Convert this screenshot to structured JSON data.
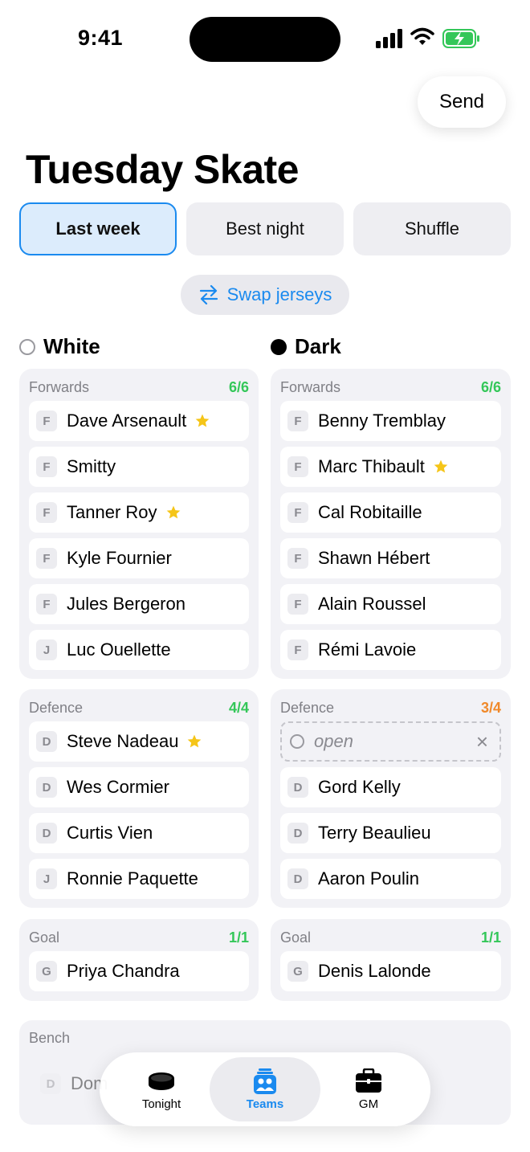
{
  "status": {
    "time": "9:41"
  },
  "header": {
    "send_label": "Send",
    "title": "Tuesday Skate"
  },
  "segments": [
    {
      "label": "Last week",
      "active": true
    },
    {
      "label": "Best night",
      "active": false
    },
    {
      "label": "Shuffle",
      "active": false
    }
  ],
  "swap_label": "Swap jerseys",
  "teams": {
    "white": {
      "name": "White",
      "forwards": {
        "label": "Forwards",
        "count": "6/6",
        "players": [
          {
            "pos": "F",
            "name": "Dave Arsenault",
            "star": true
          },
          {
            "pos": "F",
            "name": "Smitty",
            "star": false
          },
          {
            "pos": "F",
            "name": "Tanner Roy",
            "star": true
          },
          {
            "pos": "F",
            "name": "Kyle Fournier",
            "star": false
          },
          {
            "pos": "F",
            "name": "Jules Bergeron",
            "star": false
          },
          {
            "pos": "J",
            "name": "Luc Ouellette",
            "star": false
          }
        ]
      },
      "defence": {
        "label": "Defence",
        "count": "4/4",
        "players": [
          {
            "pos": "D",
            "name": "Steve Nadeau",
            "star": true
          },
          {
            "pos": "D",
            "name": "Wes Cormier",
            "star": false
          },
          {
            "pos": "D",
            "name": "Curtis Vien",
            "star": false
          },
          {
            "pos": "J",
            "name": "Ronnie Paquette",
            "star": false
          }
        ]
      },
      "goal": {
        "label": "Goal",
        "count": "1/1",
        "players": [
          {
            "pos": "G",
            "name": "Priya Chandra",
            "star": false
          }
        ]
      }
    },
    "dark": {
      "name": "Dark",
      "forwards": {
        "label": "Forwards",
        "count": "6/6",
        "players": [
          {
            "pos": "F",
            "name": "Benny Tremblay",
            "star": false
          },
          {
            "pos": "F",
            "name": "Marc Thibault",
            "star": true
          },
          {
            "pos": "F",
            "name": "Cal Robitaille",
            "star": false
          },
          {
            "pos": "F",
            "name": "Shawn Hébert",
            "star": false
          },
          {
            "pos": "F",
            "name": "Alain Roussel",
            "star": false
          },
          {
            "pos": "F",
            "name": "Rémi Lavoie",
            "star": false
          }
        ]
      },
      "defence": {
        "label": "Defence",
        "count": "3/4",
        "open_label": "open",
        "players": [
          {
            "pos": "D",
            "name": "Gord Kelly",
            "star": false
          },
          {
            "pos": "D",
            "name": "Terry Beaulieu",
            "star": false
          },
          {
            "pos": "D",
            "name": "Aaron Poulin",
            "star": false
          }
        ]
      },
      "goal": {
        "label": "Goal",
        "count": "1/1",
        "players": [
          {
            "pos": "G",
            "name": "Denis Lalonde",
            "star": false
          }
        ]
      }
    }
  },
  "bench": {
    "label": "Bench",
    "players": [
      {
        "pos": "D",
        "name": "Dom"
      }
    ]
  },
  "tabbar": [
    {
      "label": "Tonight",
      "icon": "puck-icon",
      "active": false
    },
    {
      "label": "Teams",
      "icon": "teams-icon",
      "active": true
    },
    {
      "label": "GM",
      "icon": "briefcase-icon",
      "active": false
    }
  ],
  "colors": {
    "accent": "#1a8aef",
    "full": "#34c759",
    "partial": "#f0892a",
    "star": "#f5c518"
  }
}
